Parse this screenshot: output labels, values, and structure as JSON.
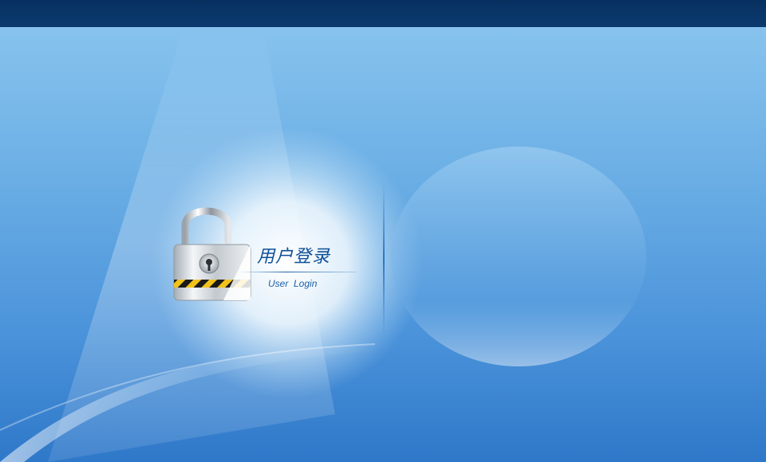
{
  "page": {
    "title": "用户登录",
    "subtitle": "User  Login"
  },
  "icons": {
    "lock": "padlock-icon"
  },
  "colors": {
    "top_bar": "#07305f",
    "background_top": "#8cc6ef",
    "background_bottom": "#2f78c9",
    "title_text": "#0d4f95",
    "accent_stripe_yellow": "#f2c21b",
    "accent_stripe_black": "#1a1a1a"
  }
}
